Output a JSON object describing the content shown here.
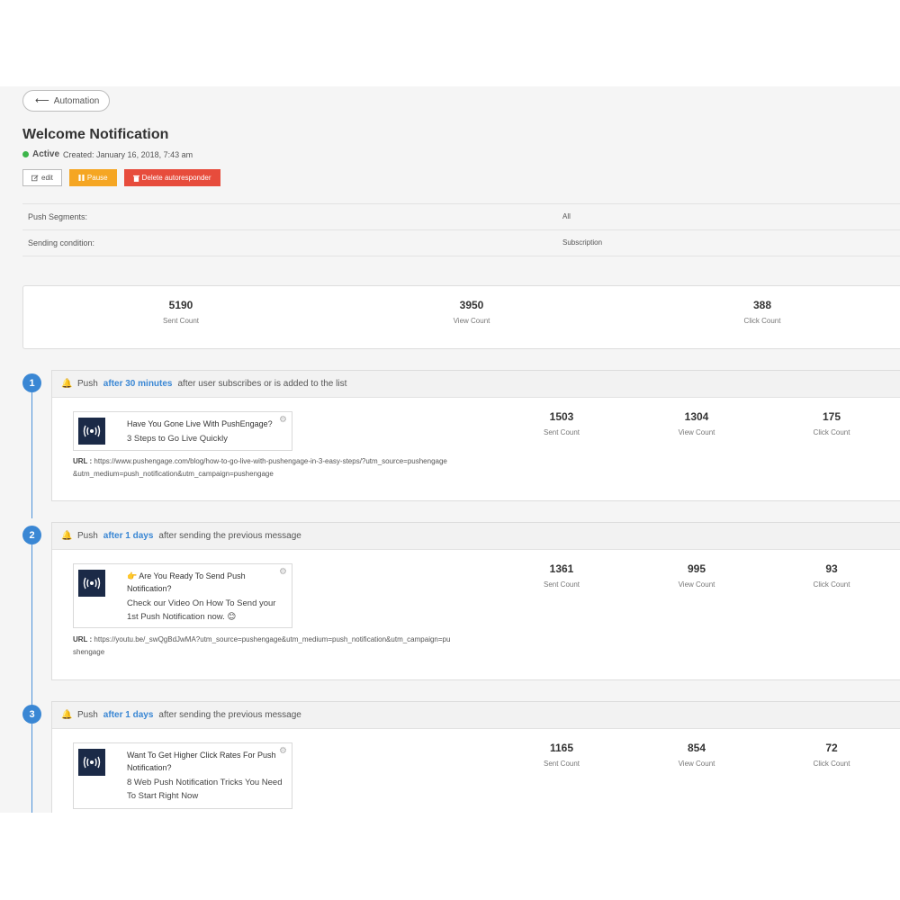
{
  "nav": {
    "back_label": "Automation"
  },
  "page": {
    "title": "Welcome Notification",
    "status": "Active",
    "created": "Created: January 16, 2018, 7:43 am"
  },
  "actions": {
    "edit": "edit",
    "pause": "Pause",
    "delete": "Delete autoresponder"
  },
  "properties": [
    {
      "label": "Push Segments:",
      "value": "All"
    },
    {
      "label": "Sending condition:",
      "value": "Subscription"
    }
  ],
  "summary": {
    "sent": {
      "value": "5190",
      "label": "Sent Count"
    },
    "view": {
      "value": "3950",
      "label": "View Count"
    },
    "click": {
      "value": "388",
      "label": "Click Count"
    }
  },
  "steps": [
    {
      "number": "1",
      "prefix": "Push",
      "delay": "after 30 minutes",
      "suffix": "after user subscribes or is added to the list",
      "notification": {
        "title": "Have You Gone Live With PushEngage?",
        "body": "3 Steps to Go Live Quickly"
      },
      "url_label": "URL :",
      "url": "https://www.pushengage.com/blog/how-to-go-live-with-pushengage-in-3-easy-steps/?utm_source=pushengage&utm_medium=push_notification&utm_campaign=pushengage",
      "stats": [
        {
          "value": "1503",
          "label": "Sent Count"
        },
        {
          "value": "1304",
          "label": "View Count"
        },
        {
          "value": "175",
          "label": "Click Count"
        }
      ]
    },
    {
      "number": "2",
      "prefix": "Push",
      "delay": "after 1 days",
      "suffix": "after sending the previous message",
      "notification": {
        "title": "👉 Are You Ready To Send Push Notification?",
        "body": "Check our Video On How To Send your 1st Push Notification now. 😊"
      },
      "url_label": "URL :",
      "url": "https://youtu.be/_swQgBdJwMA?utm_source=pushengage&utm_medium=push_notification&utm_campaign=pushengage",
      "stats": [
        {
          "value": "1361",
          "label": "Sent Count"
        },
        {
          "value": "995",
          "label": "View Count"
        },
        {
          "value": "93",
          "label": "Click Count"
        }
      ]
    },
    {
      "number": "3",
      "prefix": "Push",
      "delay": "after 1 days",
      "suffix": "after sending the previous message",
      "notification": {
        "title": "Want To Get Higher Click Rates For Push Notification?",
        "body": "8 Web Push Notification Tricks You Need To Start Right Now"
      },
      "stats": [
        {
          "value": "1165",
          "label": "Sent Count"
        },
        {
          "value": "854",
          "label": "View Count"
        },
        {
          "value": "72",
          "label": "Click Count"
        }
      ]
    }
  ],
  "colors": {
    "accent": "#3a87d4",
    "active": "#3cb54a",
    "pause": "#f5a623",
    "delete": "#e74c3c",
    "logo_bg": "#1b2a47"
  }
}
